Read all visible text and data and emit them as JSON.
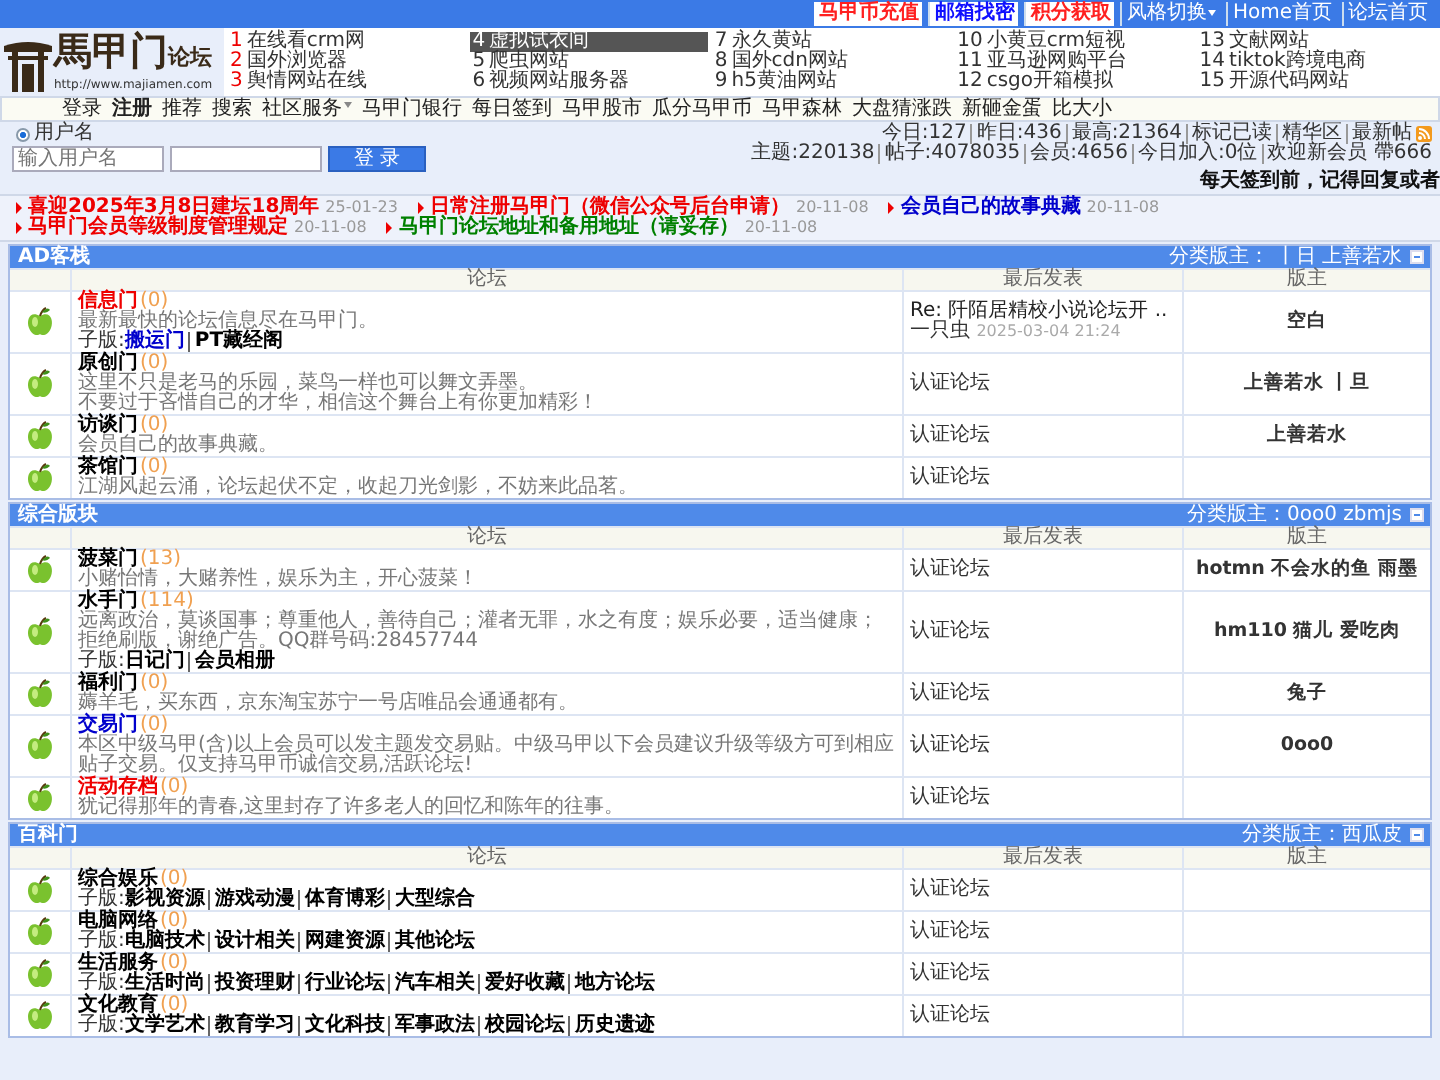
{
  "top_links": [
    {
      "label": "马甲币充值",
      "color": "#ff2020",
      "dropdown": false
    },
    {
      "label": "邮箱找密",
      "color": "#1010ff",
      "dropdown": false
    },
    {
      "label": "积分获取",
      "color": "#ff2020",
      "dropdown": false
    },
    {
      "label": "风格切换",
      "color": "#ffffff",
      "dropdown": true
    },
    {
      "label": "Home首页",
      "color": "#ffffff",
      "dropdown": false
    },
    {
      "label": "论坛首页",
      "color": "#ffffff",
      "dropdown": false
    }
  ],
  "logo": {
    "name": "馬甲门",
    "suffix": "论坛",
    "url": "http://www.majiamen.com"
  },
  "ad_links": [
    {
      "number": "1",
      "label": "在线看crm网",
      "hot": true,
      "selected": false
    },
    {
      "number": "2",
      "label": "国外浏览器",
      "hot": true,
      "selected": false
    },
    {
      "number": "3",
      "label": "舆情网站在线",
      "hot": true,
      "selected": false
    },
    {
      "number": "4",
      "label": "虚拟试衣间",
      "hot": false,
      "selected": true
    },
    {
      "number": "5",
      "label": "爬虫网站",
      "hot": false,
      "selected": false
    },
    {
      "number": "6",
      "label": "视频网站服务器",
      "hot": false,
      "selected": false
    },
    {
      "number": "7",
      "label": "永久黄站",
      "hot": false,
      "selected": false
    },
    {
      "number": "8",
      "label": "国外cdn网站",
      "hot": false,
      "selected": false
    },
    {
      "number": "9",
      "label": "h5黄油网站",
      "hot": false,
      "selected": false
    },
    {
      "number": "10",
      "label": "小黄豆crm短视",
      "hot": false,
      "selected": false
    },
    {
      "number": "11",
      "label": "亚马逊网购平台",
      "hot": false,
      "selected": false
    },
    {
      "number": "12",
      "label": "csgo开箱模拟",
      "hot": false,
      "selected": false
    },
    {
      "number": "13",
      "label": "文献网站",
      "hot": false,
      "selected": false
    },
    {
      "number": "14",
      "label": "tiktok跨境电商",
      "hot": false,
      "selected": false
    },
    {
      "number": "15",
      "label": "开源代码网站",
      "hot": false,
      "selected": false
    }
  ],
  "nav": [
    {
      "label": "登录",
      "bold": false,
      "dropdown": false
    },
    {
      "label": "注册",
      "bold": true,
      "dropdown": false
    },
    {
      "label": "推荐",
      "bold": false,
      "dropdown": false
    },
    {
      "label": "搜索",
      "bold": false,
      "dropdown": false
    },
    {
      "label": "社区服务",
      "bold": false,
      "dropdown": true
    },
    {
      "label": "马甲门银行",
      "bold": false,
      "dropdown": false
    },
    {
      "label": "每日签到",
      "bold": false,
      "dropdown": false
    },
    {
      "label": "马甲股市",
      "bold": false,
      "dropdown": false
    },
    {
      "label": "瓜分马甲币",
      "bold": false,
      "dropdown": false
    },
    {
      "label": "马甲森林",
      "bold": false,
      "dropdown": false
    },
    {
      "label": "大盘猜涨跌",
      "bold": false,
      "dropdown": false
    },
    {
      "label": "新砸金蛋",
      "bold": false,
      "dropdown": false
    },
    {
      "label": "比大小",
      "bold": false,
      "dropdown": false
    }
  ],
  "login": {
    "radio": {
      "label": "用户名",
      "selected": true
    },
    "username": {
      "placeholder": "输入用户名"
    },
    "button": "登 录"
  },
  "stats": {
    "line_1": [
      "今日:127",
      "昨日:436",
      "最高:21364",
      "标记已读",
      "精华区",
      "最新帖"
    ],
    "line_2": [
      "主题:220138",
      "帖子:4078035",
      "会员:4656",
      "今日加入:0位",
      "欢迎新会员 帶666"
    ]
  },
  "signin_notice": "每天签到前，记得回复或者",
  "announcements": [
    {
      "title": "喜迎2025年3月8日建坛18周年",
      "date": "25-01-23",
      "color": "#ee0000"
    },
    {
      "title": "日常注册马甲门（微信公众号后台申请）",
      "date": "20-11-08",
      "color": "#ee0000"
    },
    {
      "title": "会员自己的故事典藏",
      "date": "20-11-08",
      "color": "#0000cc"
    },
    {
      "title": "马甲门会员等级制度管理规定",
      "date": "20-11-08",
      "color": "#ee0000"
    },
    {
      "title": "马甲门论坛地址和备用地址（请妥存）",
      "date": "20-11-08",
      "color": "#008000"
    }
  ],
  "sections": [
    {
      "title": "AD客栈",
      "moderators": "分类版主： 丨日 上善若水",
      "columns": [
        "论坛",
        "最后发表",
        "版主"
      ],
      "forums": [
        {
          "name": "信息门",
          "color": "#ee0000",
          "count": "(0)",
          "description": [
            "最新最快的论坛信息尽在马甲门。"
          ],
          "subforums": {
            "label": "子版:",
            "items": [
              {
                "label": "搬运门",
                "color": "#0000cc"
              },
              {
                "label": "PT藏经阁",
                "color": "#000000"
              }
            ]
          },
          "last_post": {
            "title": "Re: 阡陌居精校小说论坛开 ..",
            "author": "一只虫",
            "time": "2025-03-04 21:24"
          },
          "moderator": "空白"
        },
        {
          "name": "原创门",
          "color": "#000000",
          "count": "(0)",
          "description": [
            "这里不只是老马的乐园，菜鸟一样也可以舞文弄墨。",
            "不要过于吝惜自己的才华，相信这个舞台上有你更加精彩！"
          ],
          "last_post": {
            "text": "认证论坛"
          },
          "moderator": "上善若水 丨旦"
        },
        {
          "name": "访谈门",
          "color": "#000000",
          "count": "(0)",
          "description": [
            "会员自己的故事典藏。"
          ],
          "last_post": {
            "text": "认证论坛"
          },
          "moderator": "上善若水"
        },
        {
          "name": "茶馆门",
          "color": "#000000",
          "count": "(0)",
          "description": [
            "江湖风起云涌，论坛起伏不定，收起刀光剑影，不妨来此品茗。"
          ],
          "last_post": {
            "text": "认证论坛"
          }
        }
      ]
    },
    {
      "title": "综合版块",
      "moderators": "分类版主：0oo0 zbmjs",
      "columns": [
        "论坛",
        "最后发表",
        "版主"
      ],
      "forums": [
        {
          "name": "菠菜门",
          "color": "#000000",
          "count": "(13)",
          "description": [
            "小赌怡情，大赌养性，娱乐为主，开心菠菜！"
          ],
          "last_post": {
            "text": "认证论坛"
          },
          "moderator": "hotmn 不会水的鱼 雨墨"
        },
        {
          "name": "水手门",
          "color": "#000000",
          "count": "(114)",
          "description": [
            "远离政治，莫谈国事；尊重他人，善待自己；灌者无罪，水之有度；娱乐必要，适当健康；拒绝刷版，谢绝广告。QQ群号码:28457744"
          ],
          "subforums": {
            "label": "子版:",
            "items": [
              {
                "label": "日记门",
                "color": "#000000"
              },
              {
                "label": "会员相册",
                "color": "#000000"
              }
            ]
          },
          "last_post": {
            "text": "认证论坛"
          },
          "moderator": "hm110 猫儿 爱吃肉"
        },
        {
          "name": "福利门",
          "color": "#000000",
          "count": "(0)",
          "description": [
            "薅羊毛，买东西，京东淘宝苏宁一号店唯品会通通都有。"
          ],
          "last_post": {
            "text": "认证论坛"
          },
          "moderator": "兔子"
        },
        {
          "name": "交易门",
          "color": "#0000cc",
          "count": "(0)",
          "description": [
            "本区中级马甲(含)以上会员可以发主题发交易贴。中级马甲以下会员建议升级等级方可到相应贴子交易。仅支持马甲币诚信交易,活跃论坛!"
          ],
          "last_post": {
            "text": "认证论坛"
          },
          "moderator": "0oo0"
        },
        {
          "name": "活动存档",
          "color": "#ee0000",
          "count": "(0)",
          "description": [
            "犹记得那年的青春,这里封存了许多老人的回忆和陈年的往事。"
          ],
          "last_post": {
            "text": "认证论坛"
          }
        }
      ]
    },
    {
      "title": "百科门",
      "moderators": "分类版主：西瓜皮",
      "columns": [
        "论坛",
        "最后发表",
        "版主"
      ],
      "forums": [
        {
          "name": "综合娱乐",
          "color": "#000000",
          "count": "(0)",
          "subforums": {
            "label": "子版:",
            "items": [
              {
                "label": "影视资源",
                "color": "#000000"
              },
              {
                "label": "游戏动漫",
                "color": "#000000"
              },
              {
                "label": "体育博彩",
                "color": "#000000"
              },
              {
                "label": "大型综合",
                "color": "#000000"
              }
            ]
          },
          "last_post": {
            "text": "认证论坛"
          }
        },
        {
          "name": "电脑网络",
          "color": "#000000",
          "count": "(0)",
          "subforums": {
            "label": "子版:",
            "items": [
              {
                "label": "电脑技术",
                "color": "#000000"
              },
              {
                "label": "设计相关",
                "color": "#000000"
              },
              {
                "label": "网建资源",
                "color": "#000000"
              },
              {
                "label": "其他论坛",
                "color": "#000000"
              }
            ]
          },
          "last_post": {
            "text": "认证论坛"
          }
        },
        {
          "name": "生活服务",
          "color": "#000000",
          "count": "(0)",
          "subforums": {
            "label": "子版:",
            "items": [
              {
                "label": "生活时尚",
                "color": "#000000"
              },
              {
                "label": "投资理财",
                "color": "#000000"
              },
              {
                "label": "行业论坛",
                "color": "#000000"
              },
              {
                "label": "汽车相关",
                "color": "#000000"
              },
              {
                "label": "爱好收藏",
                "color": "#000000"
              },
              {
                "label": "地方论坛",
                "color": "#000000"
              }
            ]
          },
          "last_post": {
            "text": "认证论坛"
          }
        },
        {
          "name": "文化教育",
          "color": "#000000",
          "count": "(0)",
          "subforums": {
            "label": "子版:",
            "items": [
              {
                "label": "文学艺术",
                "color": "#000000"
              },
              {
                "label": "教育学习",
                "color": "#000000"
              },
              {
                "label": "文化科技",
                "color": "#000000"
              },
              {
                "label": "军事政法",
                "color": "#000000"
              },
              {
                "label": "校园论坛",
                "color": "#000000"
              },
              {
                "label": "历史遗迹",
                "color": "#000000"
              }
            ]
          },
          "last_post": {
            "text": "认证论坛"
          }
        }
      ]
    }
  ]
}
